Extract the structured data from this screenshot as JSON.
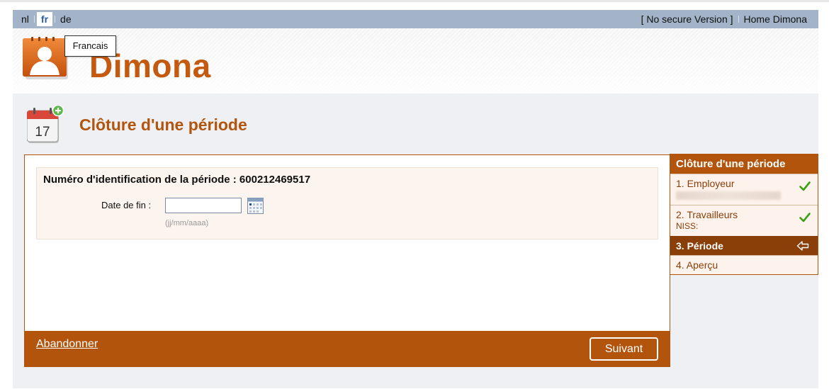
{
  "topbar": {
    "languages": [
      {
        "code": "nl",
        "active": false
      },
      {
        "code": "fr",
        "active": true
      },
      {
        "code": "de",
        "active": false
      }
    ],
    "links": [
      "[ No secure Version ]",
      "Home Dimona"
    ]
  },
  "header": {
    "logo_text": "Dimona",
    "tooltip": "Francais"
  },
  "page": {
    "title": "Clôture d'une période",
    "icon_day": "17"
  },
  "form": {
    "period_id_label": "Numéro d'identification de la période : 600212469517",
    "date_label": "Date de fin :",
    "date_value": "",
    "date_hint": "(jj/mm/aaaa)"
  },
  "footer": {
    "abandon_label": "Abandonner",
    "next_label": "Suivant"
  },
  "steps": {
    "title": "Clôture d'une période",
    "items": [
      {
        "label": "1. Employeur",
        "sub": "",
        "status": "done"
      },
      {
        "label": "2. Travailleurs",
        "sub": "NISS:",
        "status": "done"
      },
      {
        "label": "3. Période",
        "sub": "",
        "status": "current"
      },
      {
        "label": "4. Aperçu",
        "sub": "",
        "status": "todo"
      }
    ]
  },
  "colors": {
    "brand": "#b3540c",
    "brand_dark": "#8a3e08",
    "topbar": "#a3b3c8",
    "check": "#3aa014"
  }
}
